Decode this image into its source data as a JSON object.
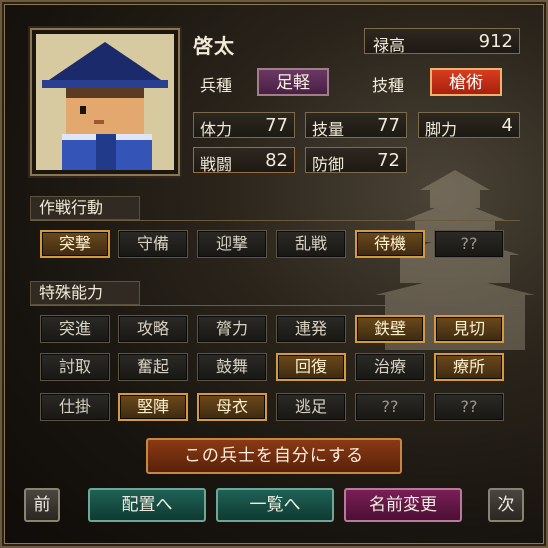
{
  "character": {
    "name": "啓太",
    "stipend_label": "禄高",
    "stipend_value": "912",
    "unit_type_label": "兵種",
    "unit_type_value": "足軽",
    "skill_type_label": "技種",
    "skill_type_value": "槍術",
    "stats": [
      {
        "label": "体力",
        "value": "77"
      },
      {
        "label": "技量",
        "value": "77"
      },
      {
        "label": "脚力",
        "value": "4"
      },
      {
        "label": "戦闘",
        "value": "82"
      },
      {
        "label": "防御",
        "value": "72"
      }
    ]
  },
  "tactics": {
    "title": "作戦行動",
    "items": [
      {
        "label": "突撃",
        "active": true
      },
      {
        "label": "守備",
        "active": false
      },
      {
        "label": "迎撃",
        "active": false
      },
      {
        "label": "乱戦",
        "active": false
      },
      {
        "label": "待機",
        "active": true
      },
      {
        "label": "??",
        "active": false
      }
    ]
  },
  "abilities": {
    "title": "特殊能力",
    "rows": [
      [
        {
          "label": "突進",
          "active": false
        },
        {
          "label": "攻略",
          "active": false
        },
        {
          "label": "膂力",
          "active": false
        },
        {
          "label": "連発",
          "active": false
        },
        {
          "label": "鉄壁",
          "active": true
        },
        {
          "label": "見切",
          "active": true
        }
      ],
      [
        {
          "label": "討取",
          "active": false
        },
        {
          "label": "奮起",
          "active": false
        },
        {
          "label": "鼓舞",
          "active": false
        },
        {
          "label": "回復",
          "active": true
        },
        {
          "label": "治療",
          "active": false
        },
        {
          "label": "療所",
          "active": true
        }
      ],
      [
        {
          "label": "仕掛",
          "active": false
        },
        {
          "label": "堅陣",
          "active": true
        },
        {
          "label": "母衣",
          "active": true
        },
        {
          "label": "逃足",
          "active": false
        },
        {
          "label": "??",
          "active": false
        },
        {
          "label": "??",
          "active": false
        }
      ]
    ]
  },
  "actions": {
    "make_own": "この兵士を自分にする",
    "prev": "前",
    "deploy": "配置へ",
    "list": "一覧へ",
    "rename": "名前変更",
    "next": "次"
  },
  "icons": {
    "portrait": "ashigaru-portrait-icon",
    "background": "castle-silhouette-icon"
  },
  "colors": {
    "active_border": "#d59a3d",
    "skill_badge": "#d63d1e",
    "unit_badge": "#6a3864"
  }
}
